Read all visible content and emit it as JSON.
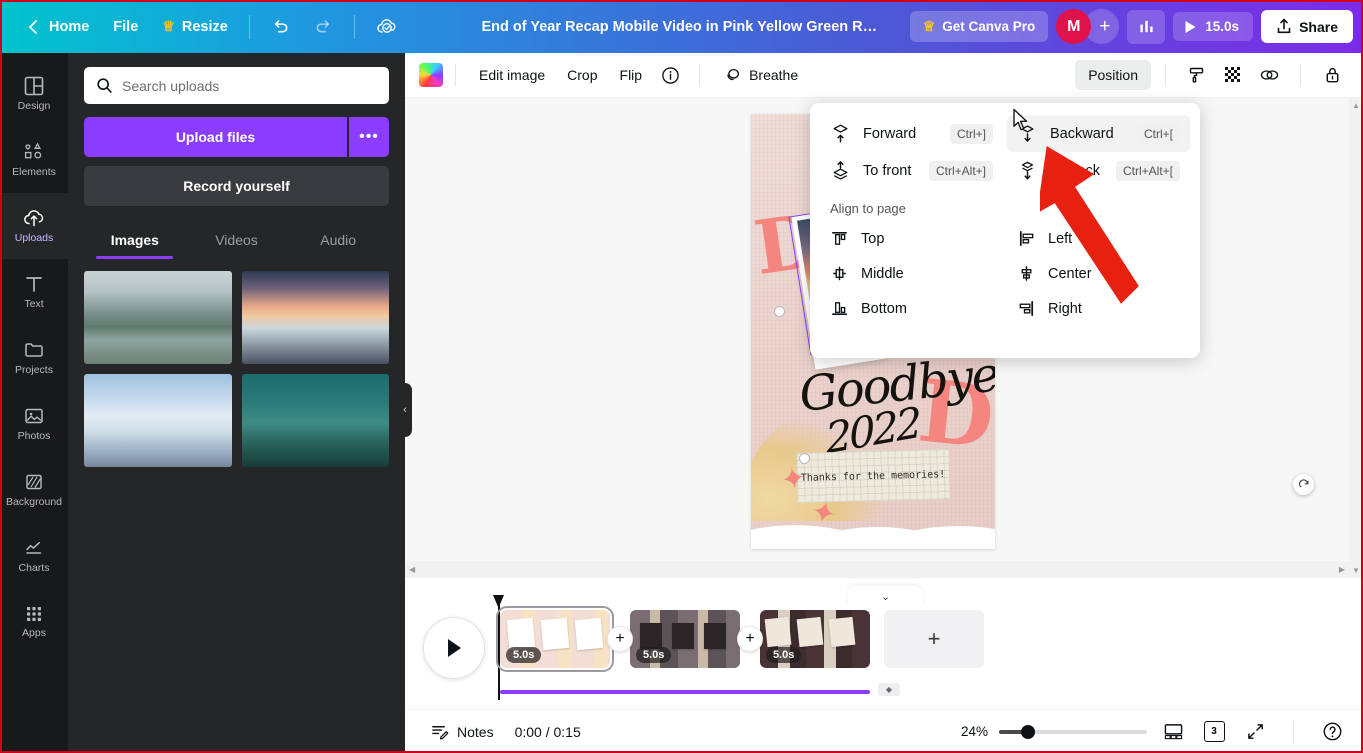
{
  "topbar": {
    "back_label": "",
    "home": "Home",
    "file": "File",
    "resize": "Resize",
    "title": "End of Year Recap Mobile Video in Pink Yellow Green Refine…",
    "get_pro": "Get Canva Pro",
    "avatar_initial": "M",
    "add_people": "+",
    "duration": "15.0s",
    "share": "Share"
  },
  "rail": {
    "items": [
      {
        "label": "Design",
        "icon": "design-icon",
        "active": false
      },
      {
        "label": "Elements",
        "icon": "elements-icon",
        "active": false
      },
      {
        "label": "Uploads",
        "icon": "uploads-icon",
        "active": true
      },
      {
        "label": "Text",
        "icon": "text-icon",
        "active": false
      },
      {
        "label": "Projects",
        "icon": "projects-icon",
        "active": false
      },
      {
        "label": "Photos",
        "icon": "photos-icon",
        "active": false
      },
      {
        "label": "Background",
        "icon": "background-icon",
        "active": false
      },
      {
        "label": "Charts",
        "icon": "charts-icon",
        "active": false
      },
      {
        "label": "Apps",
        "icon": "apps-icon",
        "active": false
      }
    ]
  },
  "panel": {
    "search_placeholder": "Search uploads",
    "search_value": "",
    "upload_files": "Upload files",
    "upload_more": "•••",
    "record_yourself": "Record yourself",
    "tabs": [
      {
        "label": "Images",
        "active": true
      },
      {
        "label": "Videos",
        "active": false
      },
      {
        "label": "Audio",
        "active": false
      }
    ],
    "thumbnails": [
      {
        "name": "misty-forest-river"
      },
      {
        "name": "sunset-mountain-lake"
      },
      {
        "name": "snow-mountain-peak"
      },
      {
        "name": "teal-night-mountain"
      }
    ],
    "collapse": "‹"
  },
  "editbar": {
    "edit_image": "Edit image",
    "crop": "Crop",
    "flip": "Flip",
    "info": "i",
    "breathe": "Breathe",
    "position": "Position"
  },
  "dropdown": {
    "items": [
      {
        "label": "Forward",
        "shortcut": "Ctrl+]",
        "icon": "forward-layer-icon",
        "hovered": false
      },
      {
        "label": "Backward",
        "shortcut": "Ctrl+[",
        "icon": "backward-layer-icon",
        "hovered": true
      },
      {
        "label": "To front",
        "shortcut": "Ctrl+Alt+]",
        "icon": "to-front-layer-icon",
        "hovered": false
      },
      {
        "label": "To back",
        "shortcut": "Ctrl+Alt+[",
        "icon": "to-back-layer-icon",
        "hovered": false
      }
    ],
    "section_title": "Align to page",
    "align": [
      {
        "label": "Top",
        "icon": "align-top-icon"
      },
      {
        "label": "Left",
        "icon": "align-left-icon"
      },
      {
        "label": "Middle",
        "icon": "align-middle-icon"
      },
      {
        "label": "Center",
        "icon": "align-center-icon"
      },
      {
        "label": "Bottom",
        "icon": "align-bottom-icon"
      },
      {
        "label": "Right",
        "icon": "align-right-icon"
      }
    ]
  },
  "canvas": {
    "headline": "Goodbye,",
    "year": "2022",
    "note": "Thanks for the\nmemories!"
  },
  "timeline": {
    "collapse": "⌄",
    "clips": [
      {
        "duration": "5.0s",
        "selected": true
      },
      {
        "duration": "5.0s",
        "selected": false
      },
      {
        "duration": "5.0s",
        "selected": false
      }
    ],
    "connector": "+",
    "add_page": "+"
  },
  "bottombar": {
    "notes": "Notes",
    "time": "0:00 / 0:15",
    "zoom": "24%",
    "page_count": "3",
    "help": "?"
  },
  "colors": {
    "accent_purple": "#8b3dff",
    "avatar_red": "#e0124a",
    "annotation_red": "#d0021b",
    "rail_bg": "#18191b",
    "panel_bg": "#252628"
  }
}
